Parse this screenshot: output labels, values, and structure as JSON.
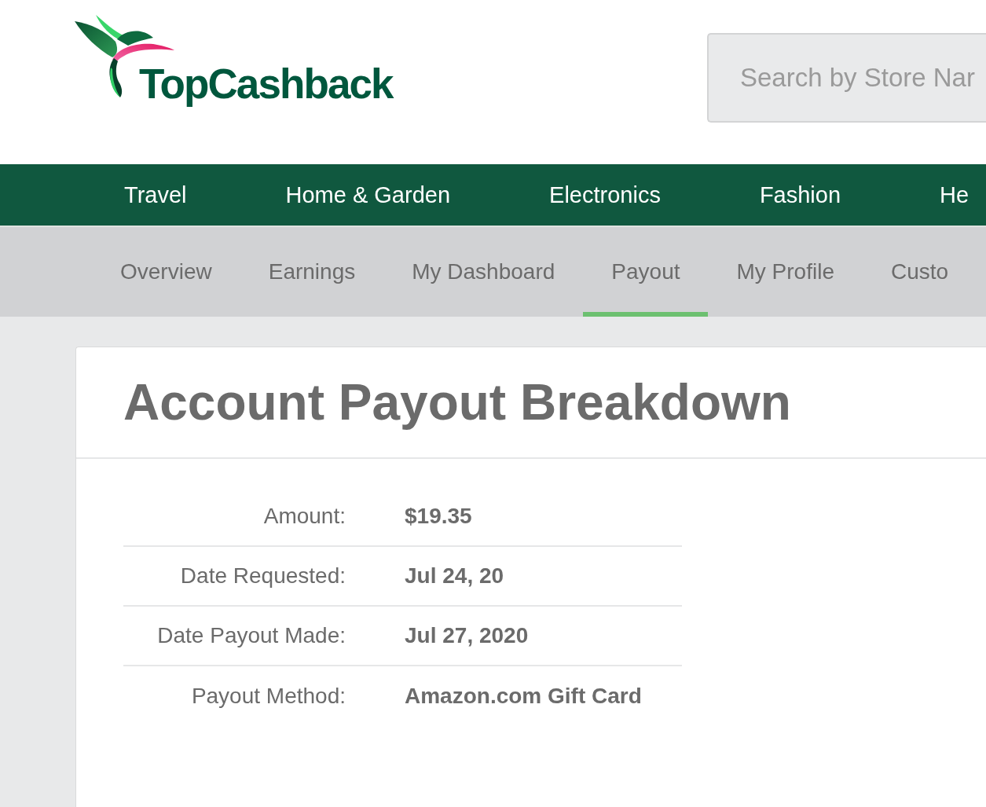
{
  "logo": {
    "text": "TopCashback"
  },
  "search": {
    "placeholder": "Search by Store Nar"
  },
  "category_nav": [
    "Travel",
    "Home & Garden",
    "Electronics",
    "Fashion",
    "He"
  ],
  "account_tabs": [
    {
      "label": "Overview",
      "selected": false
    },
    {
      "label": "Earnings",
      "selected": false
    },
    {
      "label": "My Dashboard",
      "selected": false
    },
    {
      "label": "Payout",
      "selected": true
    },
    {
      "label": "My Profile",
      "selected": false
    },
    {
      "label": "Custo",
      "selected": false
    }
  ],
  "card": {
    "title": "Account Payout Breakdown",
    "rows": [
      {
        "label": "Amount:",
        "value": "$19.35"
      },
      {
        "label": "Date Requested:",
        "value": "Jul 24, 20"
      },
      {
        "label": "Date Payout Made:",
        "value": "Jul 27, 2020"
      },
      {
        "label": "Payout Method:",
        "value": "Amazon.com Gift Card"
      }
    ]
  }
}
